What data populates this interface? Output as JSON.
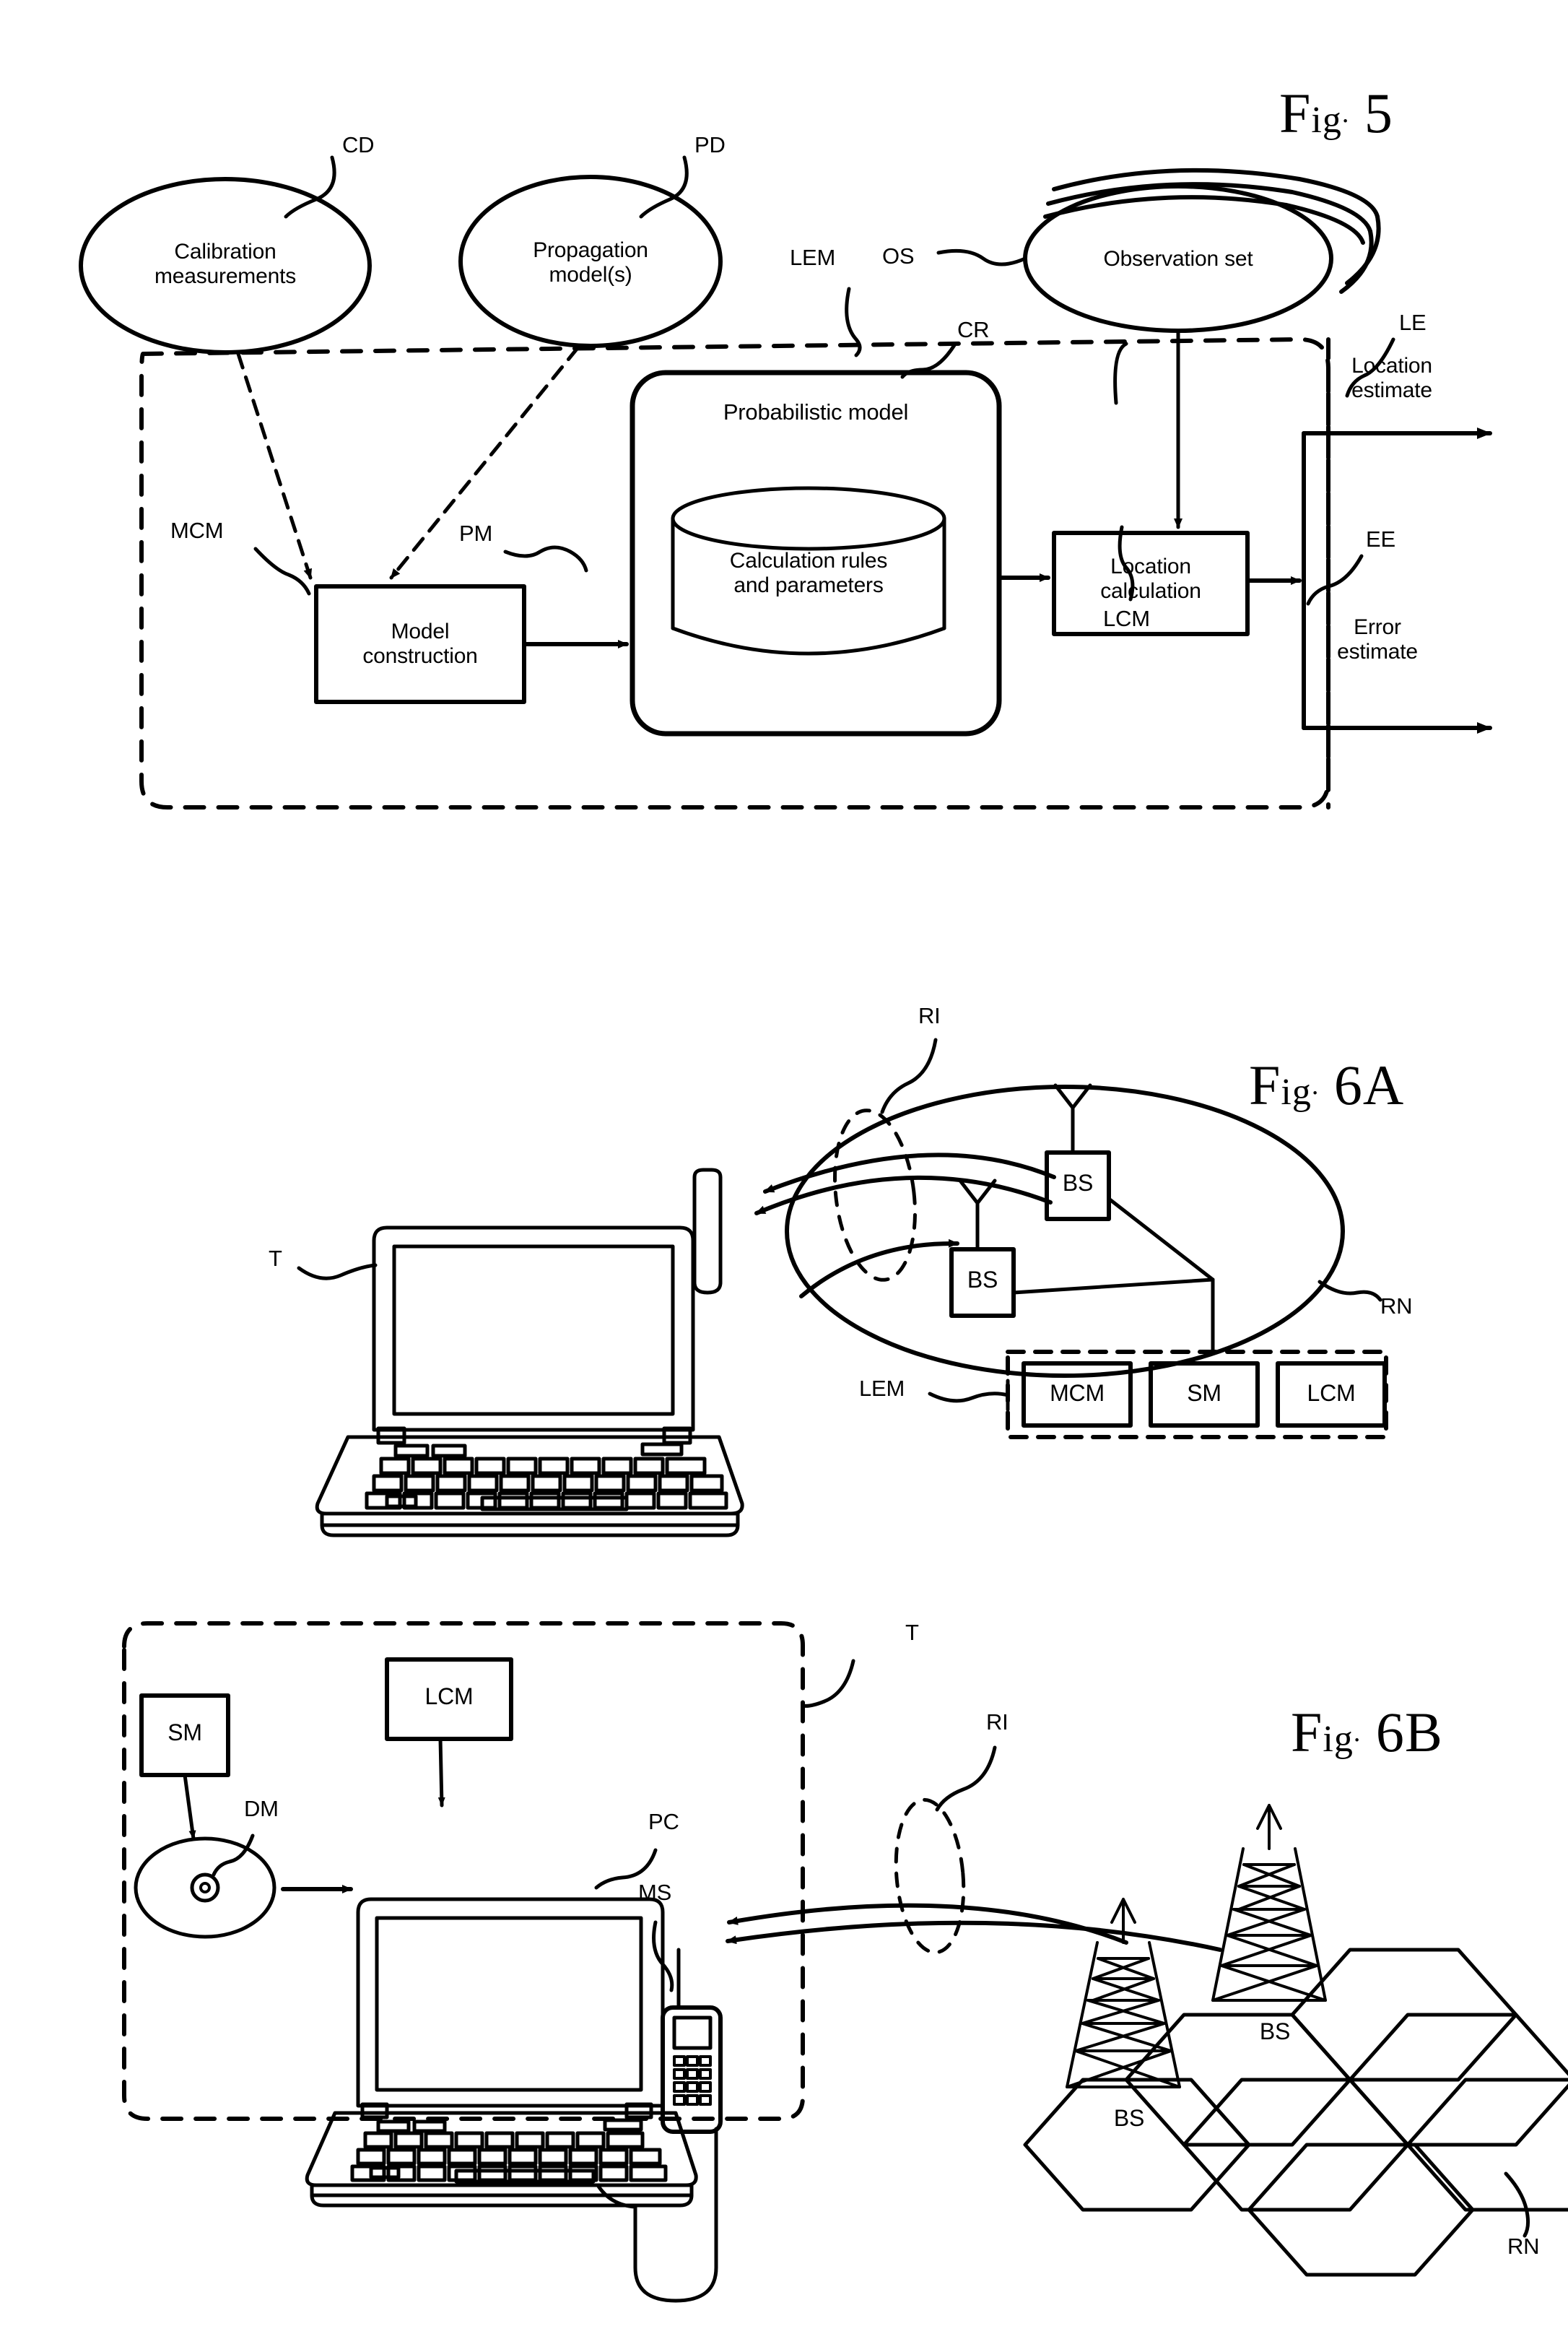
{
  "sheet": {
    "figures": [
      {
        "id": "fig5",
        "title_prefix": "F",
        "title_mid": "ig",
        "title_num": "5",
        "caption": "Fig. 5",
        "nodes": {
          "calibration": "Calibration\nmeasurements",
          "propagation": "Propagation\nmodel(s)",
          "observation": "Observation set",
          "probabilistic": "Probabilistic model",
          "calcrules": "Calculation rules\nand parameters",
          "modelconstruction": "Model\nconstruction",
          "locationcalc": "Location\ncalculation",
          "locationestimate": "Location\nestimate",
          "errorestimate": "Error\nestimate"
        },
        "refs": {
          "cd": "CD",
          "pd": "PD",
          "lem": "LEM",
          "os": "OS",
          "le": "LE",
          "ee": "EE",
          "cr": "CR",
          "mcm": "MCM",
          "pm": "PM",
          "lcm": "LCM"
        }
      },
      {
        "id": "fig6a",
        "title_prefix": "F",
        "title_mid": "ig",
        "title_num": "6A",
        "caption": "Fig. 6A",
        "refs": {
          "t": "T",
          "ri": "RI",
          "rn": "RN",
          "lem": "LEM"
        },
        "nodes": {
          "bs_upper": "BS",
          "bs_lower": "BS",
          "mcm": "MCM",
          "sm": "SM",
          "lcm": "LCM"
        }
      },
      {
        "id": "fig6b",
        "title_prefix": "F",
        "title_mid": "ig",
        "title_num": "6B",
        "caption": "Fig. 6B",
        "refs": {
          "t": "T",
          "ri": "RI",
          "rn": "RN",
          "pc": "PC",
          "ms": "MS",
          "dm": "DM"
        },
        "nodes": {
          "sm": "SM",
          "lcm": "LCM",
          "bs_left": "BS",
          "bs_right": "BS"
        }
      }
    ]
  },
  "colors": {
    "ink": "#000000",
    "paper": "#ffffff"
  }
}
